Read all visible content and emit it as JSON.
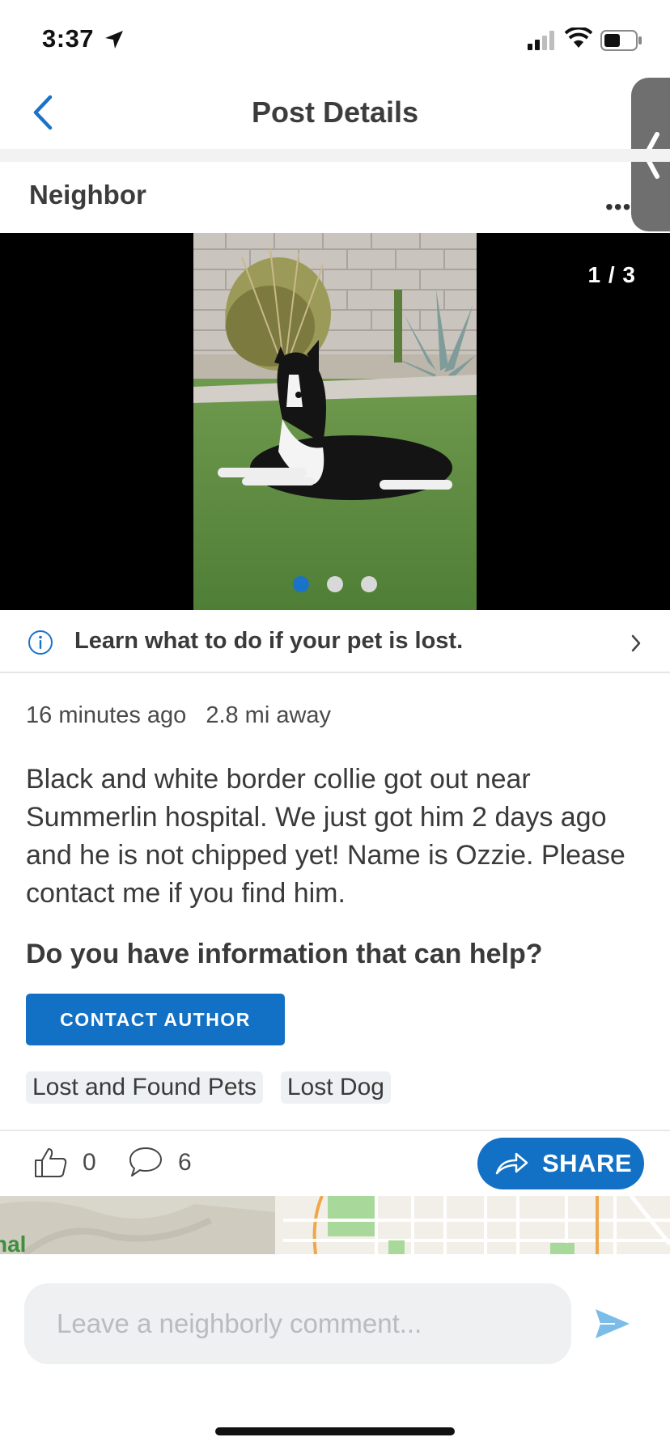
{
  "status_bar": {
    "time": "3:37",
    "icons": [
      "location-arrow-icon",
      "cellular-signal-icon",
      "wifi-icon",
      "battery-icon"
    ]
  },
  "nav": {
    "title": "Post Details",
    "back_icon": "chevron-left-icon"
  },
  "author": {
    "name": "Neighbor",
    "more_label": "•••"
  },
  "photo": {
    "counter": "1 / 3",
    "total": 3,
    "active_index": 0
  },
  "info_banner": {
    "text": "Learn what to do if your pet is lost.",
    "icon": "info-icon"
  },
  "post": {
    "time_ago": "16 minutes ago",
    "distance": "2.8 mi away",
    "body": "Black and white border collie got out near Summerlin hospital. We just got him 2 days ago and he is not chipped yet! Name is Ozzie. Please contact me if you find him.",
    "help_heading": "Do you have information that can help?",
    "contact_label": "CONTACT AUTHOR",
    "tags": [
      "Lost and Found Pets",
      "Lost Dog"
    ]
  },
  "actions": {
    "like_count": "0",
    "comment_count": "6",
    "share_label": "SHARE"
  },
  "map": {
    "label": "nal"
  },
  "comment_box": {
    "placeholder": "Leave a neighborly comment..."
  },
  "colors": {
    "accent": "#1271c4",
    "info_icon": "#1a73c8",
    "send_icon": "#7bbde8"
  }
}
